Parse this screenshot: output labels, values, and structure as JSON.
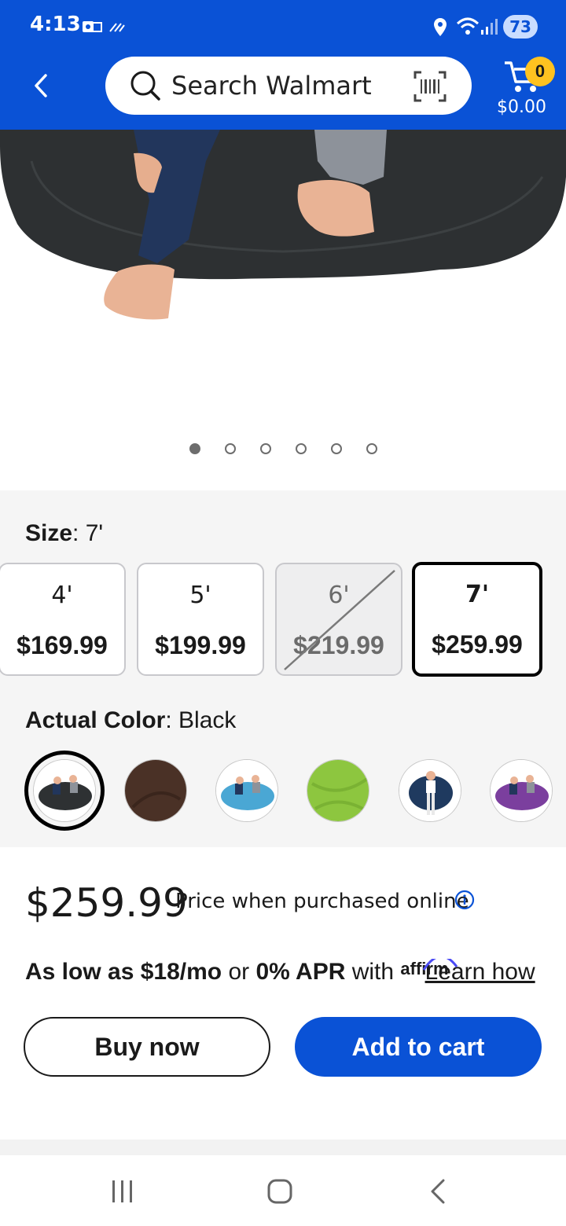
{
  "status_bar": {
    "time": "4:13",
    "battery": "73",
    "icons": [
      "outlook-icon",
      "wifi-calling-icon",
      "location-icon",
      "wifi-icon",
      "signal-icon"
    ]
  },
  "header": {
    "search_placeholder": "Search Walmart",
    "cart_count": "0",
    "cart_total": "$0.00",
    "color": "#0a52d6"
  },
  "gallery": {
    "total_images": 6,
    "active_index": 0
  },
  "size": {
    "label": "Size",
    "selected": "7'",
    "options": [
      {
        "size": "4'",
        "price": "$169.99"
      },
      {
        "size": "5'",
        "price": "$199.99"
      },
      {
        "size": "6'",
        "price": "$219.99"
      },
      {
        "size": "7'",
        "price": "$259.99"
      }
    ]
  },
  "color": {
    "label": "Actual Color",
    "selected": "Black",
    "swatch_colors": [
      "#2e3133",
      "#4a3126",
      "#4aa7d4",
      "#8dc63f",
      "#1f3a5f",
      "#7b3f9e"
    ]
  },
  "price": {
    "current": "$259.99",
    "note": "Price when purchased online"
  },
  "financing": {
    "prefix": "As low as $18/mo",
    "or": " or ",
    "apr": "0% APR",
    "with": " with ",
    "brand": "affirm",
    "link": "Learn how"
  },
  "actions": {
    "buy_now": "Buy now",
    "add_to_cart": "Add to cart"
  }
}
